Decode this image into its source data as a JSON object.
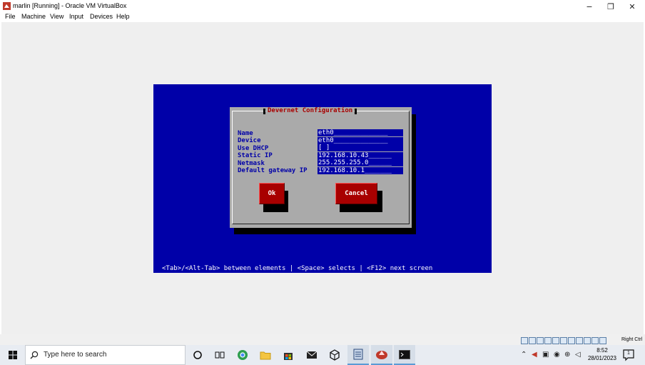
{
  "window": {
    "title": "marlin [Running] - Oracle VM VirtualBox",
    "minimize_glyph": "−",
    "maximize_glyph": "❐",
    "close_glyph": "✕"
  },
  "menu": {
    "items": [
      "File",
      "Machine",
      "View",
      "Input",
      "Devices",
      "Help"
    ]
  },
  "guest": {
    "dialog_title": "Devernet Configuration",
    "fields": [
      {
        "label": "Name",
        "value": "eth0______________"
      },
      {
        "label": "Device",
        "value": "eth0______________"
      },
      {
        "label": "Use DHCP",
        "value": "[ ]"
      },
      {
        "label": "Static IP",
        "value": "192.168.10.43______"
      },
      {
        "label": "Netmask",
        "value": "255.255.255.0______"
      },
      {
        "label": "Default gateway IP",
        "value": "192.168.10.1_______"
      }
    ],
    "ok_label": "Ok",
    "cancel_label": "Cancel",
    "hint": "<Tab>/<Alt-Tab> between elements   |  <Space> selects  |  <F12> next screen"
  },
  "statusbar": {
    "host_key": "Right Ctrl"
  },
  "taskbar": {
    "search_placeholder": "Type here to search",
    "time": "8:52",
    "date": "28/01/2023",
    "notification_count": "1"
  },
  "colors": {
    "guest_bg": "#0000a8",
    "dialog_bg": "#aaaaaa",
    "button_red": "#a80000",
    "title_red": "#a80000"
  }
}
